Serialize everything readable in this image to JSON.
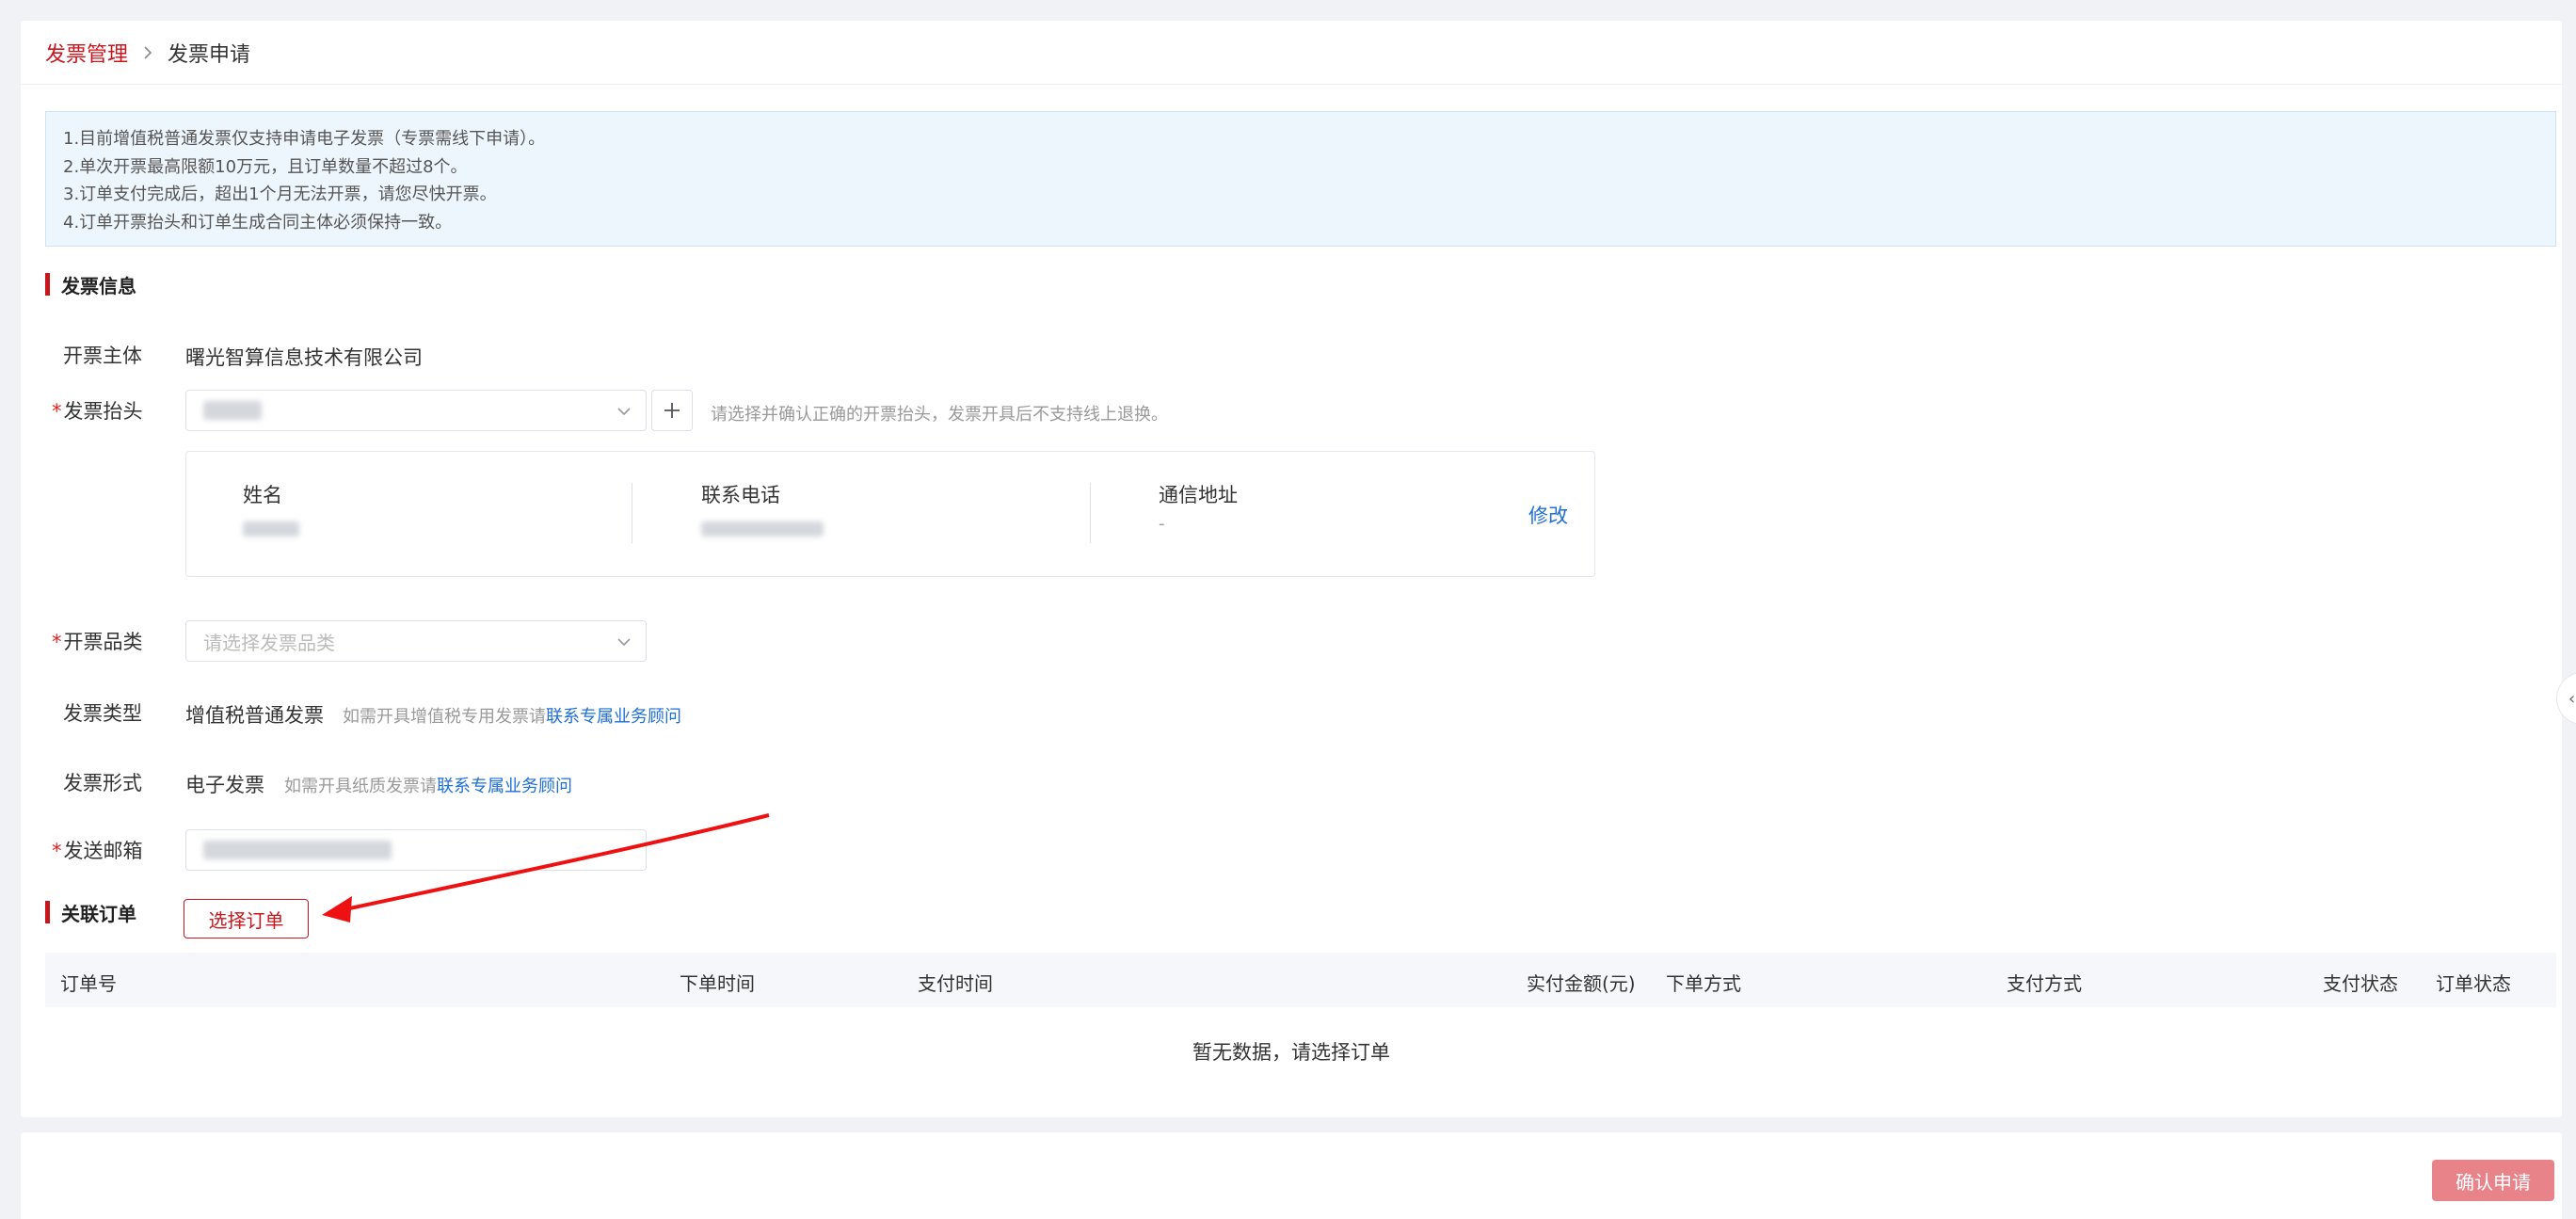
{
  "breadcrumb": {
    "parent": "发票管理",
    "current": "发票申请"
  },
  "notice": {
    "lines": [
      "1.目前增值税普通发票仅支持申请电子发票（专票需线下申请）。",
      "2.单次开票最高限额10万元，且订单数量不超过8个。",
      "3.订单支付完成后，超出1个月无法开票，请您尽快开票。",
      "4.订单开票抬头和订单生成合同主体必须保持一致。"
    ]
  },
  "invoice_info": {
    "section_title": "发票信息",
    "issuer": {
      "label": "开票主体",
      "value": "曙光智算信息技术有限公司"
    },
    "title": {
      "label": "发票抬头",
      "required_mark": "*",
      "hint": "请选择并确认正确的开票抬头，发票开具后不支持线上退换。"
    },
    "contact": {
      "name_label": "姓名",
      "phone_label": "联系电话",
      "address_label": "通信地址",
      "address_value": "-",
      "edit_label": "修改"
    },
    "category": {
      "label": "开票品类",
      "required_mark": "*",
      "placeholder": "请选择发票品类"
    },
    "type": {
      "label": "发票类型",
      "value": "增值税普通发票",
      "hint": "如需开具增值税专用发票请",
      "hint_link": "联系专属业务顾问"
    },
    "form": {
      "label": "发票形式",
      "value": "电子发票",
      "hint": "如需开具纸质发票请",
      "hint_link": "联系专属业务顾问"
    },
    "email": {
      "label": "发送邮箱",
      "required_mark": "*"
    }
  },
  "orders": {
    "section_title": "关联订单",
    "select_button": "选择订单",
    "columns": [
      "订单号",
      "下单时间",
      "支付时间",
      "实付金额(元)",
      "下单方式",
      "支付方式",
      "支付状态",
      "订单状态"
    ],
    "empty_text": "暂无数据，请选择订单"
  },
  "footer": {
    "confirm_button": "确认申请"
  },
  "side_handle_icon": "‹",
  "colors": {
    "brand": "#c8161d",
    "link": "#1e6fd6",
    "confirm": "#e9838a",
    "notice_bg": "#eef6fd"
  }
}
